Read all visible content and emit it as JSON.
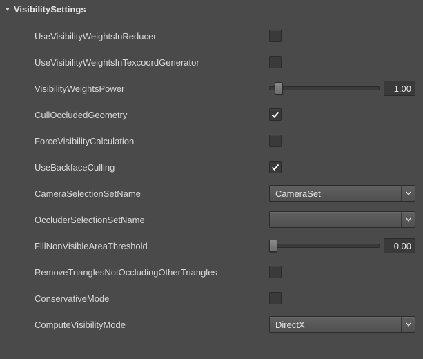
{
  "section": {
    "title": "VisibilitySettings"
  },
  "rows": {
    "useVisibilityWeightsInReducer": {
      "label": "UseVisibilityWeightsInReducer",
      "checked": false
    },
    "useVisibilityWeightsInTexcoordGenerator": {
      "label": "UseVisibilityWeightsInTexcoordGenerator",
      "checked": false
    },
    "visibilityWeightsPower": {
      "label": "VisibilityWeightsPower",
      "value": "1.00",
      "pos": 8
    },
    "cullOccludedGeometry": {
      "label": "CullOccludedGeometry",
      "checked": true
    },
    "forceVisibilityCalculation": {
      "label": "ForceVisibilityCalculation",
      "checked": false
    },
    "useBackfaceCulling": {
      "label": "UseBackfaceCulling",
      "checked": true
    },
    "cameraSelectionSetName": {
      "label": "CameraSelectionSetName",
      "value": "CameraSet"
    },
    "occluderSelectionSetName": {
      "label": "OccluderSelectionSetName",
      "value": ""
    },
    "fillNonVisibleAreaThreshold": {
      "label": "FillNonVisibleAreaThreshold",
      "value": "0.00",
      "pos": 3
    },
    "removeTrianglesNotOccludingOtherTriangles": {
      "label": "RemoveTrianglesNotOccludingOtherTriangles",
      "checked": false
    },
    "conservativeMode": {
      "label": "ConservativeMode",
      "checked": false
    },
    "computeVisibilityMode": {
      "label": "ComputeVisibilityMode",
      "value": "DirectX"
    }
  }
}
